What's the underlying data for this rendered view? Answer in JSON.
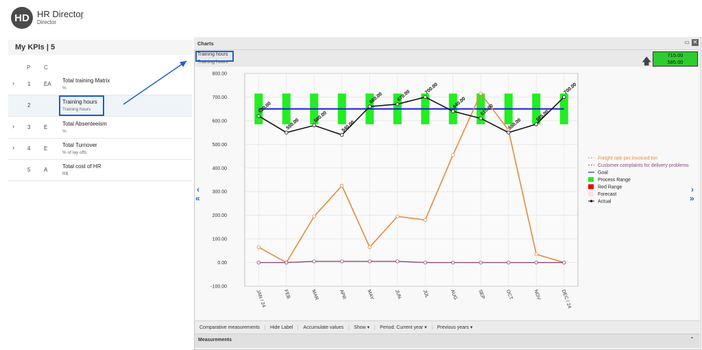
{
  "header": {
    "avatar_initials": "HD",
    "user_name": "HR Director",
    "user_role": "Director"
  },
  "kpi_panel": {
    "title": "My KPIs | 5",
    "columns": [
      "P",
      "C"
    ],
    "rows": [
      {
        "p": "1",
        "c": "EA",
        "name": "Total training Matrix",
        "sub": "%",
        "expandable": true
      },
      {
        "p": "2",
        "c": "",
        "name": "Training hours",
        "sub": "Training hours",
        "expandable": false
      },
      {
        "p": "3",
        "c": "E",
        "name": "Total Absenteeism",
        "sub": "%",
        "expandable": true
      },
      {
        "p": "4",
        "c": "E",
        "name": "Total Turnover",
        "sub": "% of lay offs",
        "expandable": true
      },
      {
        "p": "5",
        "c": "A",
        "name": "Total cost of HR",
        "sub": "R$",
        "expandable": false
      }
    ]
  },
  "charts_panel": {
    "title": "Charts",
    "chart_name": "Training hours",
    "chart_subname": "Training hours",
    "badge": {
      "top": "715.00",
      "bottom": "585.00",
      "color": "#2ecc2e"
    },
    "toolbar": [
      "Comparative measurements",
      "Hide Label",
      "Accumulate values",
      "Show ▾",
      "Period: Current year ▾",
      "Previous years ▾"
    ],
    "measurements_title": "Measurements"
  },
  "chart_data": {
    "type": "line",
    "categories": [
      "JAN / 24",
      "FEB",
      "MAR",
      "APR",
      "MAY",
      "JUN",
      "JUL",
      "AUG",
      "SEP",
      "OCT",
      "NOV",
      "DEC / 24"
    ],
    "ylim": [
      -100,
      800
    ],
    "yticks": [
      "800.00",
      "700.00",
      "600.00",
      "500.00",
      "400.00",
      "300.00",
      "200.00",
      "100.00",
      "0.00",
      "-100.00"
    ],
    "grid": true,
    "legend_position": "right",
    "process_range": [
      585,
      715
    ],
    "series": [
      {
        "name": "Freight rate per invoiced ton",
        "color": "#e8883a",
        "values": [
          65,
          0,
          195,
          325,
          65,
          195,
          180,
          455,
          715,
          560,
          35,
          0
        ]
      },
      {
        "name": "Customer complaints for delivery problems",
        "color": "#8a4a7a",
        "values": [
          0,
          0,
          5,
          5,
          5,
          5,
          0,
          0,
          0,
          0,
          0,
          0
        ]
      },
      {
        "name": "Goal",
        "color": "#2222dd",
        "values": [
          650,
          650,
          650,
          650,
          650,
          650,
          650,
          650,
          650,
          650,
          650,
          650
        ]
      },
      {
        "name": "Process Range",
        "color": "#22ee22"
      },
      {
        "name": "Red Range",
        "color": "#ee0000"
      },
      {
        "name": "Forecast",
        "color": "#ffe0e0"
      },
      {
        "name": "Actual",
        "color": "#111111",
        "values": [
          620,
          550,
          580,
          540,
          660,
          670,
          700,
          640,
          610,
          550,
          585,
          700
        ],
        "labels": [
          "620.00",
          "550.00",
          "580.00",
          "540.00",
          "660.00",
          "670.00",
          "700.00",
          "640.00",
          "610.00",
          "550.00",
          "585.00",
          "700.00"
        ]
      }
    ]
  }
}
